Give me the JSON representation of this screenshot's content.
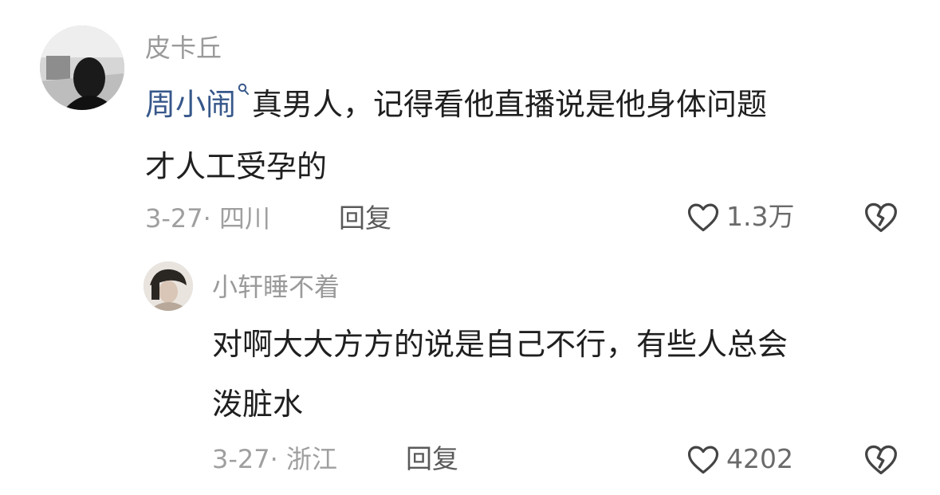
{
  "comments": [
    {
      "username": "皮卡丘",
      "mention": "周小闹",
      "text_line1": "真男人，记得看他直播说是他身体问题",
      "text_line2": "才人工受孕的",
      "date": "3-27",
      "separator": "·",
      "location": "四川",
      "reply_label": "回复",
      "like_count": "1.3万"
    },
    {
      "username": "小轩睡不着",
      "text_line1": "对啊大大方方的说是自己不行，有些人总会",
      "text_line2": "泼脏水",
      "date": "3-27",
      "separator": "·",
      "location": "浙江",
      "reply_label": "回复",
      "like_count": "4202"
    }
  ],
  "icons": {
    "like": "heart-outline-icon",
    "dislike": "broken-heart-icon",
    "mention": "search-mention-icon"
  },
  "colors": {
    "mention": "#36578a",
    "username": "#9a9a9a",
    "body": "#1f1f1f",
    "meta": "#9f9f9f"
  }
}
